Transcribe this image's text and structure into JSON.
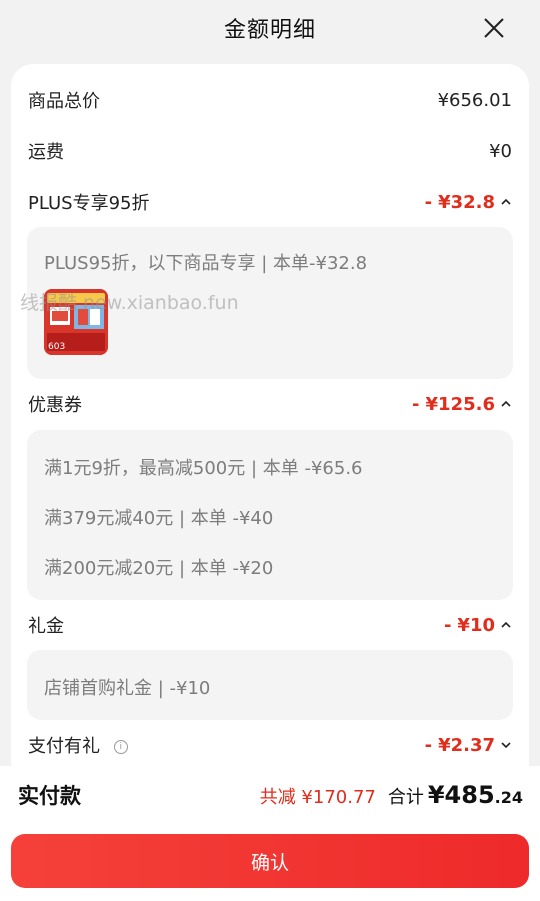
{
  "header": {
    "title": "金额明细"
  },
  "rows": {
    "subtotal": {
      "label": "商品总价",
      "value": "¥656.01"
    },
    "shipping": {
      "label": "运费",
      "value": "¥0"
    },
    "plus": {
      "label": "PLUS专享95折",
      "minus": "-",
      "value": "¥32.8"
    },
    "coupon": {
      "label": "优惠券",
      "minus": "-",
      "value": "¥125.6"
    },
    "gift": {
      "label": "礼金",
      "minus": "-",
      "value": "¥10"
    },
    "payment": {
      "label": "支付有礼",
      "minus": "-",
      "value": "¥2.37"
    }
  },
  "plus_detail": {
    "line": "PLUS95折，以下商品专享 | 本单-¥32.8"
  },
  "coupon_detail": [
    "满1元9折，最高减500元 | 本单 -¥65.6",
    "满379元减40元 | 本单 -¥40",
    "满200元减20元 | 本单 -¥20"
  ],
  "gift_detail": {
    "line": "店铺首购礼金 | -¥10"
  },
  "watermark": "线报酷 new.xianbao.fun",
  "product_thumb": {
    "badge": "603"
  },
  "footer": {
    "label": "实付款",
    "saved": "共减 ¥170.77",
    "total_label": "合计",
    "total_int": "¥485",
    "total_dec": ".24"
  },
  "confirm_label": "确认",
  "icons": {
    "close": "close-icon",
    "chevron_up": "chevron-up-icon",
    "chevron_down": "chevron-down-icon",
    "info": "info-icon"
  },
  "colors": {
    "accent": "#e12d1c",
    "button": "#f03a33",
    "background": "#f2f2f2"
  }
}
